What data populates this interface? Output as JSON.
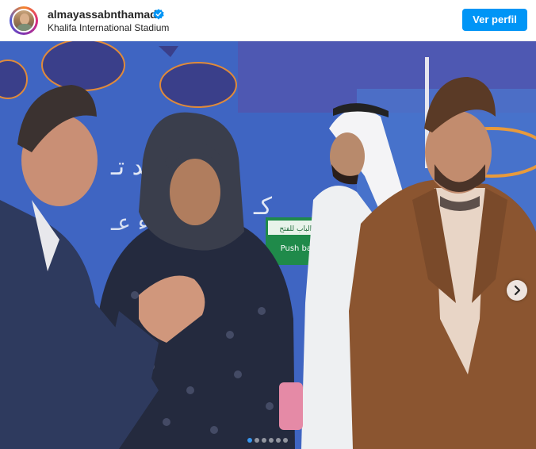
{
  "header": {
    "username": "almayassabnthamad",
    "location": "Khalifa International Stadium",
    "follow_button": "Ver perfil",
    "verified": true
  },
  "photo": {
    "sign_text": "Push bar to",
    "sign_text_arabic": "ادفع الباب للفتح"
  },
  "carousel": {
    "dot_count": 6,
    "active_index": 0
  },
  "colors": {
    "accent": "#0095f6",
    "text": "#262626",
    "backdrop": "#3d62c0"
  },
  "icons": {
    "verified": "verified-badge-icon",
    "next": "chevron-right-icon"
  }
}
